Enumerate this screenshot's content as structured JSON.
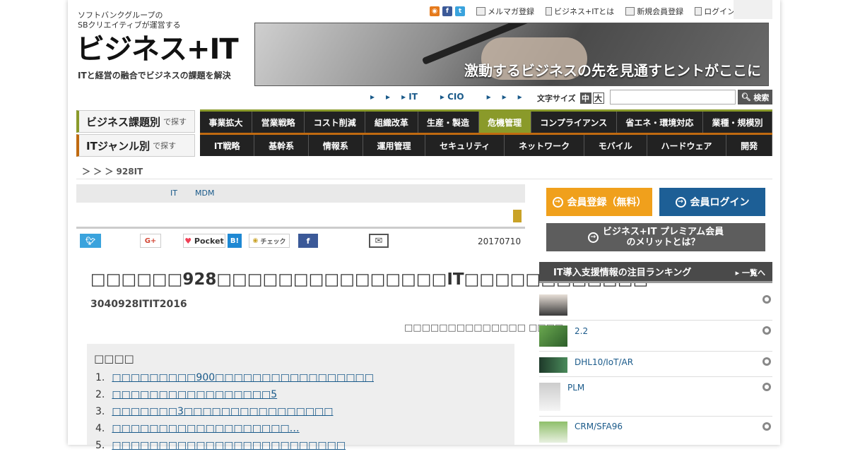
{
  "header": {
    "logo_tagline_1": "ソフトバンクグループの",
    "logo_tagline_2": "SBクリエイティブが運営する",
    "logo": "ビジネス+IT",
    "logo_sub": "ITと経営の融合でビジネスの課題を解決",
    "top_links": [
      "メルマガ登録",
      "ビジネス+ITとは",
      "新規会員登録",
      "ログイン"
    ],
    "banner_text": "激動するビジネスの先を見通すヒントがここに",
    "subnav": [
      "IT",
      "CIO"
    ],
    "font_size_label": "文字サイズ",
    "font_size_options": [
      "中",
      "大"
    ],
    "search_placeholder": "",
    "search_button": "検索"
  },
  "nav": {
    "row1_label": "ビジネス課題別",
    "row1_suffix": "で探す",
    "row1": [
      "事業拡大",
      "営業戦略",
      "コスト削減",
      "組織改革",
      "生産・製造",
      "危機管理",
      "コンプライアンス",
      "省エネ・環境対応",
      "業種・規模別"
    ],
    "row2_label": "ITジャンル別",
    "row2_suffix": "で探す",
    "row2": [
      "IT戦略",
      "基幹系",
      "情報系",
      "運用管理",
      "セキュリティ",
      "ネットワーク",
      "モバイル",
      "ハードウェア",
      "開発"
    ],
    "active": "危機管理"
  },
  "breadcrumb": "＞ ＞ ＞ 928IT",
  "article": {
    "tags": [
      "IT",
      "MDM"
    ],
    "share": {
      "pocket": "Pocket",
      "hatena": "B!",
      "check": "チェック"
    },
    "date": "20170710",
    "title": "□□□□□□928□□□□□□□□□□□□□□□IT□□□□□□□□□□□□",
    "subtitle": "3040928ITIT2016",
    "author": "□□□□□□□□□□□□□□ □□□□",
    "toc_heading": "□□□□",
    "toc": [
      {
        "num": "1.",
        "text": "□□□□□□□□□900□□□□□□□□□□□□□□□□□"
      },
      {
        "num": "2.",
        "text": "□□□□□□□□□□□□□□□□□5"
      },
      {
        "num": "3.",
        "text": "□□□□□□□3□□□□□□□□□□□□□□□□"
      },
      {
        "num": "4.",
        "text": "□□□□□□□□□□□□□□□□□□□…"
      },
      {
        "num": "5.",
        "text": "□□□□□□□□□□□□□□□□□□□□□□□□□"
      }
    ]
  },
  "sidebar": {
    "register": "会員登録（無料）",
    "login": "会員ログイン",
    "premium_1": "ビジネス+IT プレミアム会員",
    "premium_2": "のメリットとは？",
    "ranking_title": "IT導入支援情報の注目ランキング",
    "ranking_more": "一覧へ",
    "ranking": [
      "",
      "2.2",
      "DHL10/IoT/AR",
      "PLM",
      "CRM/SFA96"
    ]
  },
  "colors": {
    "accent_orange": "#f0a01c",
    "accent_blue": "#1d5f96",
    "nav_green": "#8a9a2a",
    "nav_orange": "#c06a10"
  }
}
